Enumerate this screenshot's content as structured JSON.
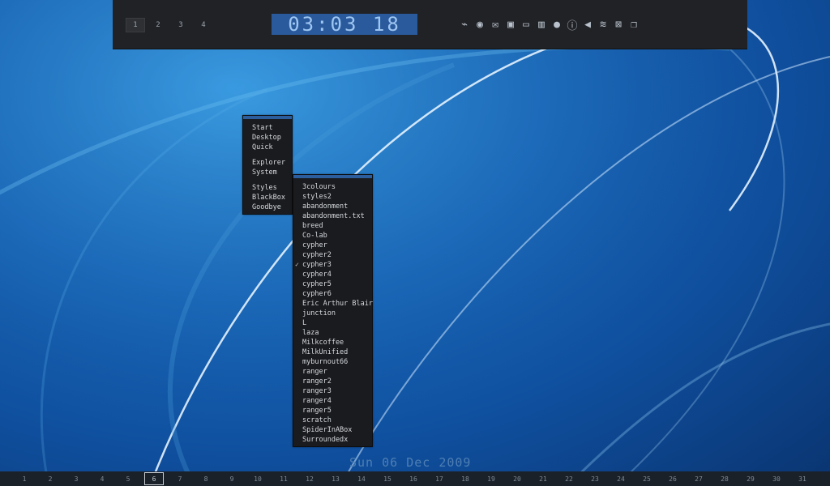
{
  "top_bar": {
    "workspaces": [
      {
        "label": "1",
        "active": true
      },
      {
        "label": "2",
        "active": false
      },
      {
        "label": "3",
        "active": false
      },
      {
        "label": "4",
        "active": false
      }
    ],
    "clock": "03:03 18",
    "tray_icons": [
      {
        "name": "network-icon",
        "glyph": "⌁"
      },
      {
        "name": "satellite-icon",
        "glyph": "◉"
      },
      {
        "name": "mail-icon",
        "glyph": "✉"
      },
      {
        "name": "monitor-icon",
        "glyph": "▣"
      },
      {
        "name": "computer-icon",
        "glyph": "▭"
      },
      {
        "name": "cabinet-icon",
        "glyph": "▥"
      },
      {
        "name": "sphere-icon",
        "glyph": "●"
      },
      {
        "name": "info-icon",
        "glyph": "ⓘ"
      },
      {
        "name": "volume-icon",
        "glyph": "◀"
      },
      {
        "name": "wireless-icon",
        "glyph": "≋"
      },
      {
        "name": "disconnected-icon",
        "glyph": "⊠"
      },
      {
        "name": "windows-icon",
        "glyph": "❐"
      }
    ]
  },
  "root_menu": {
    "groups": [
      [
        "Start",
        "Desktop",
        "Quick"
      ],
      [
        "Explorer",
        "System"
      ],
      [
        "Styles",
        "BlackBox",
        "Goodbye"
      ]
    ]
  },
  "styles_menu": {
    "checked": "cypher3",
    "items": [
      "3colours",
      "styles2",
      "abandonment",
      "abandonment.txt",
      "breed",
      "Co-lab",
      "cypher",
      "cypher2",
      "cypher3",
      "cypher4",
      "cypher5",
      "cypher6",
      "Eric Arthur Blair",
      "junction",
      "L",
      "laza",
      "Milkcoffee",
      "MilkUnified",
      "myburnout66",
      "ranger",
      "ranger2",
      "ranger3",
      "ranger4",
      "ranger5",
      "scratch",
      "SpiderInABox",
      "Surroundedx"
    ]
  },
  "date": "Sun 06 Dec  2009",
  "calendar": {
    "today": "6",
    "days": [
      "1",
      "2",
      "3",
      "4",
      "5",
      "6",
      "7",
      "8",
      "9",
      "10",
      "11",
      "12",
      "13",
      "14",
      "15",
      "16",
      "17",
      "18",
      "19",
      "20",
      "21",
      "22",
      "23",
      "24",
      "25",
      "26",
      "27",
      "28",
      "29",
      "30",
      "31"
    ]
  }
}
